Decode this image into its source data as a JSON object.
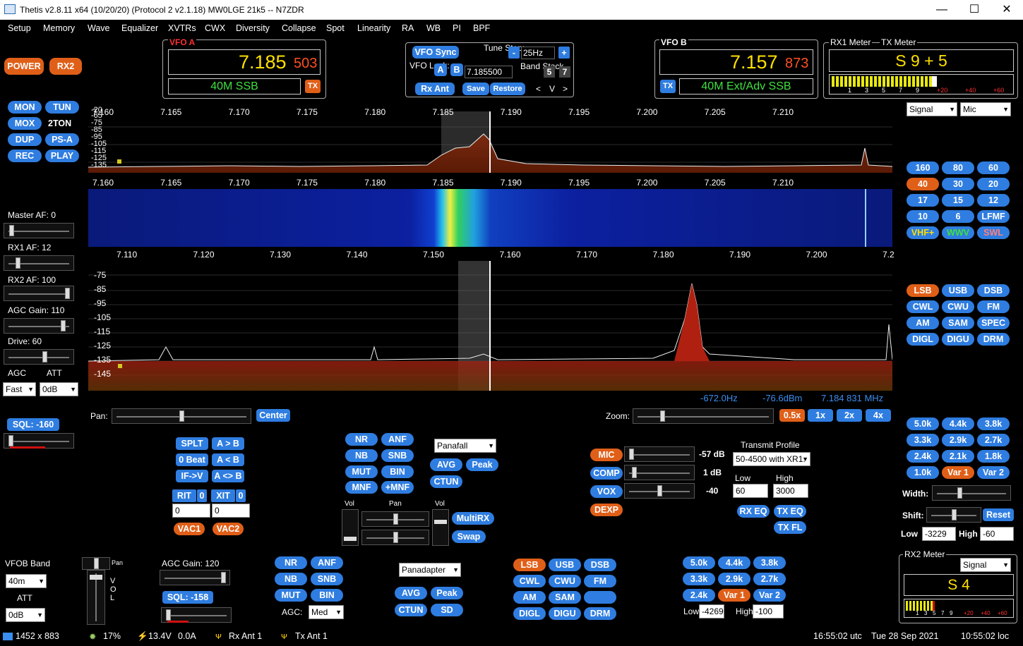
{
  "window": {
    "title": "Thetis v2.8.11 x64 (10/20/20) (Protocol 2 v2.1.18) MW0LGE 21k5  --   N7ZDR",
    "minimize": "—",
    "maximize": "☐",
    "close": "✕"
  },
  "menu": [
    "Setup",
    "Memory",
    "Wave",
    "Equalizer",
    "XVTRs",
    "CWX",
    "Diversity",
    "Collapse",
    "Spot",
    "Linearity",
    "RA",
    "WB",
    "PI",
    "BPF"
  ],
  "left_buttons": {
    "power": "POWER",
    "rx2": "RX2",
    "mon": "MON",
    "tun": "TUN",
    "mox": "MOX",
    "two_ton": "2TON",
    "dup": "DUP",
    "psa": "PS-A",
    "rec": "REC",
    "play": "PLAY"
  },
  "vfo_a": {
    "label": "VFO A",
    "freq_main": "7.185",
    "freq_sub": "503",
    "mode": "40M SSB",
    "tx": "TX"
  },
  "vfo_b": {
    "label": "VFO B",
    "freq_main": "7.157",
    "freq_sub": "873",
    "mode": "40M Ext/Adv SSB",
    "tx": "TX"
  },
  "vfo_center": {
    "vfo_sync": "VFO Sync",
    "tune_step_label": "Tune Step:",
    "tune_step_minus": "-",
    "tune_step": "25Hz",
    "tune_step_plus": "+",
    "vfo_lock": "VFO Lock:",
    "lock_a": "A",
    "lock_b": "B",
    "lock_freq": "7.185500",
    "band_stack": "Band Stack",
    "bs_5": "5",
    "bs_7": "7",
    "rx_ant": "Rx Ant",
    "save": "Save",
    "restore": "Restore",
    "nav_prev": "<",
    "nav_v": "V",
    "nav_next": ">"
  },
  "meters": {
    "rx1_label": "RX1 Meter",
    "tx_label": "TX Meter",
    "rx1_reading": "S 9 + 5",
    "scale": [
      "1",
      "3",
      "5",
      "7",
      "9",
      "+20",
      "+40",
      "+60"
    ],
    "rx1_select": "Signal",
    "tx_select": "Mic",
    "rx2_label": "RX2 Meter",
    "rx2_reading": "S 4",
    "rx2_select": "Signal",
    "rx2_scale": [
      "1",
      "3",
      "5",
      "7",
      "9",
      "+20",
      "+40",
      "+60"
    ]
  },
  "band_buttons": [
    "160",
    "80",
    "60",
    "40",
    "30",
    "20",
    "17",
    "15",
    "12",
    "10",
    "6",
    "LFMF",
    "VHF+",
    "WWV",
    "SWL"
  ],
  "mode_buttons": [
    "LSB",
    "USB",
    "DSB",
    "CWL",
    "CWU",
    "FM",
    "AM",
    "SAM",
    "SPEC",
    "DIGL",
    "DIGU",
    "DRM"
  ],
  "filter_buttons": [
    "5.0k",
    "4.4k",
    "3.8k",
    "3.3k",
    "2.9k",
    "2.7k",
    "2.4k",
    "2.1k",
    "1.8k",
    "1.0k",
    "Var 1",
    "Var 2"
  ],
  "filter_controls": {
    "width": "Width:",
    "shift": "Shift:",
    "reset": "Reset",
    "low": "Low",
    "low_val": "-3229",
    "high": "High",
    "high_val": "-60"
  },
  "left_panel": {
    "master_af": "Master AF:  0",
    "rx1_af": "RX1 AF:  12",
    "rx2_af": "RX2 AF:  100",
    "agc_gain": "AGC Gain:  110",
    "drive": "Drive:  60",
    "agc": "AGC",
    "att": "ATT",
    "agc_val": "Fast",
    "att_val": "0dB",
    "sql": "SQL: -160"
  },
  "panadapter1": {
    "freq_ticks": [
      "7.160",
      "7.165",
      "7.170",
      "7.175",
      "7.180",
      "7.185",
      "7.190",
      "7.195",
      "7.200",
      "7.205",
      "7.210"
    ],
    "db_ticks": [
      "-20",
      "-65",
      "-75",
      "-85",
      "-95",
      "-105",
      "-115",
      "-125",
      "-135"
    ]
  },
  "waterfall": {
    "freq_ticks": [
      "7.160",
      "7.165",
      "7.170",
      "7.175",
      "7.180",
      "7.185",
      "7.190",
      "7.195",
      "7.200",
      "7.205",
      "7.210"
    ]
  },
  "panadapter2": {
    "freq_ticks": [
      "7.110",
      "7.120",
      "7.130",
      "7.140",
      "7.150",
      "7.160",
      "7.170",
      "7.180",
      "7.190",
      "7.200",
      "7.2"
    ],
    "db_ticks": [
      "-75",
      "-85",
      "-95",
      "-105",
      "-115",
      "-125",
      "-135",
      "-145"
    ],
    "readout_offset": "-672.0Hz",
    "readout_dbm": "-76.6dBm",
    "readout_freq": "7.184 831 MHz"
  },
  "pan_zoom": {
    "pan": "Pan:",
    "center": "Center",
    "zoom": "Zoom:",
    "z05": "0.5x",
    "z1": "1x",
    "z2": "2x",
    "z4": "4x"
  },
  "rx1_controls": {
    "splt": "SPLT",
    "a_to_b": "A > B",
    "zero_beat": "0 Beat",
    "a_lt_b": "A < B",
    "if_v": "IF->V",
    "a_swap_b": "A <> B",
    "rit": "RIT",
    "rit_badge": "0",
    "xit": "XIT",
    "xit_badge": "0",
    "rit_val": "0",
    "xit_val": "0",
    "vac1": "VAC1",
    "vac2": "VAC2"
  },
  "dsp1": {
    "nr": "NR",
    "anf": "ANF",
    "nb": "NB",
    "snb": "SNB",
    "mut": "MUT",
    "bin": "BIN",
    "mnf": "MNF",
    "pmnf": "+MNF",
    "display_mode": "Panafall",
    "avg": "AVG",
    "peak": "Peak",
    "ctun": "CTUN",
    "vol": "Vol",
    "pan": "Pan",
    "vol2": "Vol",
    "multirx": "MultiRX",
    "swap": "Swap"
  },
  "tx_controls": {
    "mic": "MIC",
    "mic_val": "-57 dB",
    "comp": "COMP",
    "comp_val": "1 dB",
    "vox": "VOX",
    "vox_val": "-40",
    "dexp": "DEXP",
    "profile_label": "Transmit Profile",
    "profile": "50-4500 with XR1.",
    "low": "Low",
    "high": "High",
    "low_val": "60",
    "high_val": "3000",
    "rx_eq": "RX EQ",
    "tx_eq": "TX EQ",
    "tx_fl": "TX FL"
  },
  "rx2_bottom": {
    "vfob_band": "VFOB Band",
    "band": "40m",
    "att": "ATT",
    "att_val": "0dB",
    "pan": "Pan",
    "vol": "V O L",
    "agc_gain": "AGC Gain:  120",
    "sql": "SQL:  -158",
    "nr": "NR",
    "anf": "ANF",
    "nb": "NB",
    "snb": "SNB",
    "mut": "MUT",
    "bin": "BIN",
    "agc": "AGC:",
    "agc_val": "Med",
    "display_mode": "Panadapter",
    "avg": "AVG",
    "peak": "Peak",
    "ctun": "CTUN",
    "sd": "SD",
    "modes": [
      "LSB",
      "USB",
      "DSB",
      "CWL",
      "CWU",
      "FM",
      "AM",
      "SAM",
      "",
      "DIGL",
      "DIGU",
      "DRM"
    ],
    "filters": [
      "5.0k",
      "4.4k",
      "3.8k",
      "3.3k",
      "2.9k",
      "2.7k",
      "2.4k",
      "Var 1",
      "Var 2"
    ],
    "low": "Low",
    "low_val": "-4269",
    "high": "High",
    "high_val": "-100"
  },
  "status": {
    "res": "1452 x 883",
    "cpu": "17%",
    "volts": "13.4V",
    "amps": "0.0A",
    "rx_ant": "Rx Ant 1",
    "tx_ant": "Tx Ant 1",
    "utc": "16:55:02 utc",
    "date": "Tue 28 Sep 2021",
    "loc": "10:55:02 loc"
  },
  "colors": {
    "accent": "#2f7de0",
    "orange": "#e05f18",
    "freq_yellow": "#ffe000",
    "freq_red": "#ff5020",
    "mode_green": "#40e040"
  }
}
